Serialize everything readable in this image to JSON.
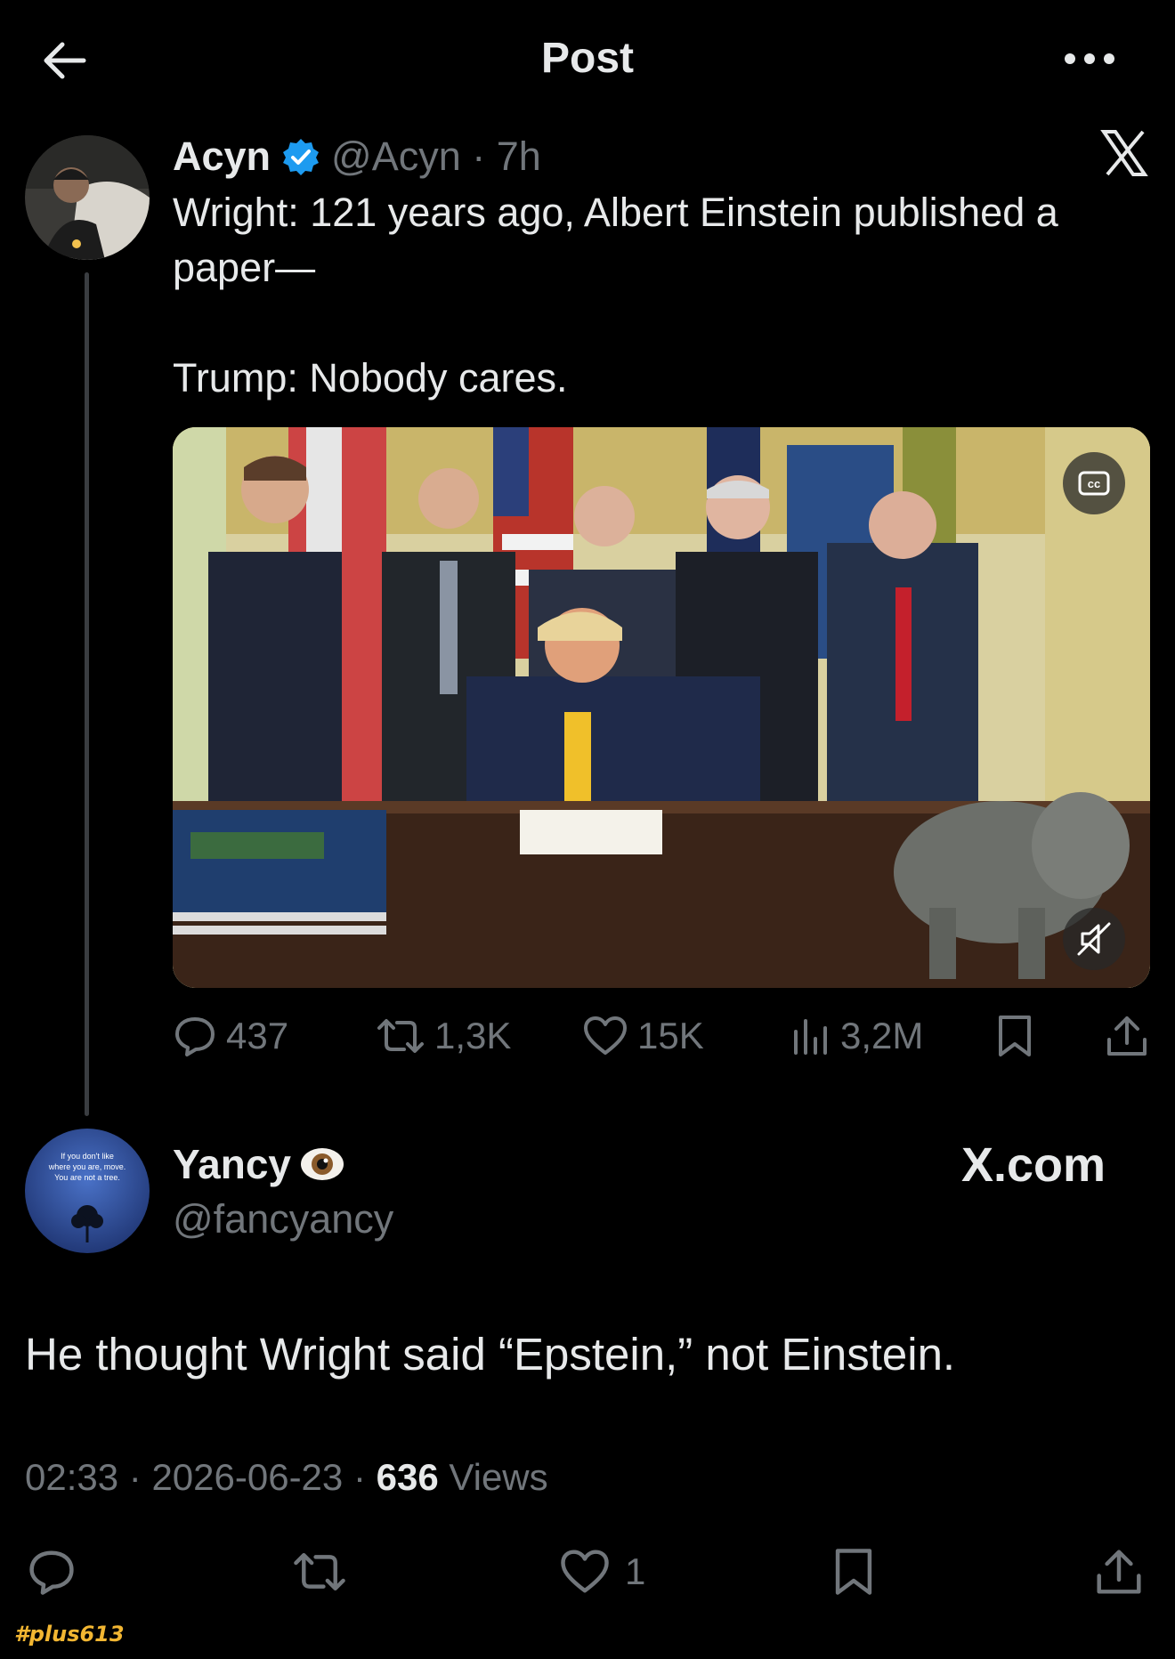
{
  "header": {
    "title": "Post"
  },
  "quoted_post": {
    "author_name": "Acyn",
    "handle_time": "@Acyn · 7h",
    "text_line1": "Wright: 121 years ago, Albert Einstein published a paper—",
    "text_line2": "Trump: Nobody cares.",
    "stats": {
      "replies": "437",
      "reposts": "1,3K",
      "likes": "15K",
      "views": "3,2M"
    },
    "verified_color": "#1d9bf0"
  },
  "reply": {
    "author_name": "Yancy",
    "handle": "@fancyancy",
    "source_label": "X.com",
    "text": "He thought Wright said “Epstein,” not Einstein.",
    "time": "02:33",
    "date": "2026-06-23",
    "views_count": "636",
    "views_label": "Views",
    "likes": "1",
    "avatar_text": "If you don't like where you are, move. You are not a tree."
  },
  "watermark": "#plus613",
  "colors": {
    "background": "#000000",
    "text_primary": "#e7e9ea",
    "text_secondary": "#71767b",
    "accent": "#1d9bf0"
  }
}
